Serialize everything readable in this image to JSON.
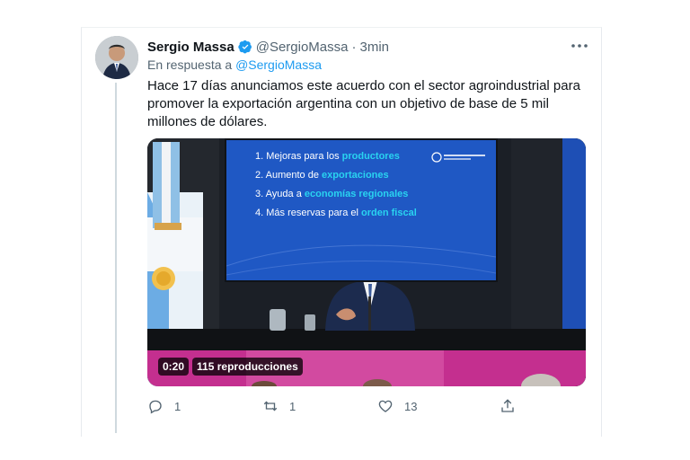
{
  "tweet": {
    "author_name": "Sergio Massa",
    "handle": "@SergioMassa",
    "separator": "·",
    "time": "3min",
    "reply_prefix": "En respuesta a",
    "reply_mention": "@SergioMassa",
    "text": "Hace 17 días anunciamos este acuerdo con el sector agroindustrial para promover la exportación argentina con un objetivo de base de 5 mil millones de dólares."
  },
  "media": {
    "slide": [
      {
        "num": "1.",
        "pre": "Mejoras para los",
        "highlight": "productores"
      },
      {
        "num": "2.",
        "pre": "Aumento de",
        "highlight": "exportaciones"
      },
      {
        "num": "3.",
        "pre": "Ayuda a",
        "highlight": "economías regionales"
      },
      {
        "num": "4.",
        "pre": "Más reservas para el",
        "highlight": "orden fiscal"
      }
    ],
    "duration": "0:20",
    "views": "115 reproducciones"
  },
  "actions": {
    "reply_count": "1",
    "retweet_count": "1",
    "like_count": "13"
  },
  "icons": [
    "verified-icon",
    "more-icon",
    "reply-icon",
    "retweet-icon",
    "like-icon",
    "share-icon"
  ],
  "colors": {
    "accent": "#1d9bf0",
    "muted": "#536471",
    "text": "#0f1419",
    "slide_bg": "#1f58c4",
    "slide_highlight": "#29d3f0"
  }
}
